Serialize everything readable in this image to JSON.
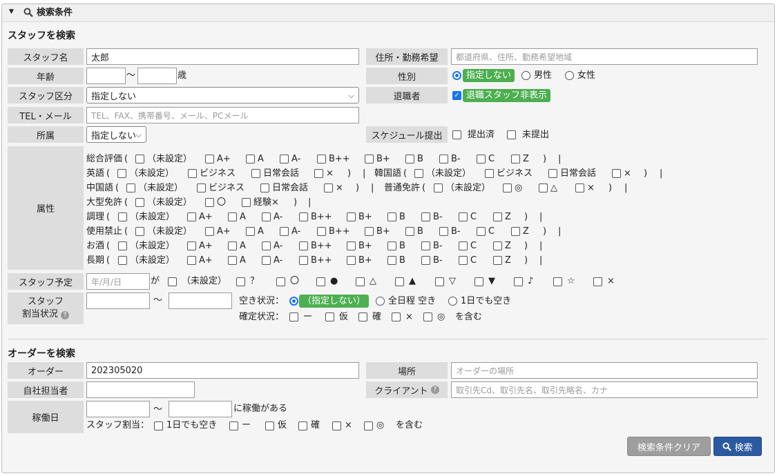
{
  "header": {
    "title": "検索条件"
  },
  "staff": {
    "title": "スタッフを検索",
    "name_label": "スタッフ名",
    "name_value": "太郎",
    "address_label": "住所・勤務希望",
    "address_placeholder": "都道府県、住所、勤務希望地域",
    "age_label": "年齢",
    "age_sep": "〜",
    "age_unit": "歳",
    "gender_label": "性別",
    "gender_options": [
      "指定しない",
      "男性",
      "女性"
    ],
    "category_label": "スタッフ区分",
    "category_value": "指定しない",
    "retired_label": "退職者",
    "retired_option": "退職スタッフ非表示",
    "tel_label": "TEL・メール",
    "tel_placeholder": "TEL、FAX、携帯番号、メール、PCメール",
    "belong_label": "所属",
    "belong_value": "指定しない",
    "schedule_label": "スケジュール提出",
    "schedule_options": [
      "提出済",
      "未提出"
    ],
    "attr_label": "属性",
    "attrs": [
      {
        "name": "総合評価",
        "items": [
          "（未設定）",
          "A+",
          "A",
          "A-",
          "B++",
          "B+",
          "B",
          "B-",
          "C",
          "Z"
        ]
      },
      {
        "name": "英語",
        "items": [
          "（未設定）",
          "ビジネス",
          "日常会話",
          "×"
        ]
      },
      {
        "name": "韓国語",
        "items": [
          "（未設定）",
          "ビジネス",
          "日常会話",
          "×"
        ]
      },
      {
        "name": "中国語",
        "items": [
          "（未設定）",
          "ビジネス",
          "日常会話",
          "×"
        ]
      },
      {
        "name": "普通免許",
        "items": [
          "（未設定）",
          "◎",
          "△",
          "×"
        ]
      },
      {
        "name": "大型免許",
        "items": [
          "（未設定）",
          "〇",
          "経験×"
        ]
      },
      {
        "name": "調理",
        "items": [
          "（未設定）",
          "A+",
          "A",
          "A-",
          "B++",
          "B+",
          "B",
          "B-",
          "C",
          "Z"
        ]
      },
      {
        "name": "使用禁止",
        "items": [
          "（未設定）",
          "A+",
          "A",
          "A-",
          "B++",
          "B+",
          "B",
          "B-",
          "C",
          "Z"
        ]
      },
      {
        "name": "お酒",
        "items": [
          "（未設定）",
          "A+",
          "A",
          "A-",
          "B++",
          "B+",
          "B",
          "B-",
          "C",
          "Z"
        ]
      },
      {
        "name": "長期",
        "items": [
          "（未設定）",
          "A+",
          "A",
          "A-",
          "B++",
          "B+",
          "B",
          "B-",
          "C",
          "Z"
        ]
      }
    ],
    "plan_label": "スタッフ予定",
    "plan_placeholder": "年/月/日",
    "plan_ga": "が",
    "plan_items": [
      "（未設定）",
      "？",
      "〇",
      "●",
      "△",
      "▲",
      "▽",
      "▼",
      "♪",
      "☆",
      "×"
    ],
    "assign_label1": "スタッフ",
    "assign_label2": "割当状況",
    "vacancy_label": "空き状況：",
    "vacancy_options": [
      "（指定しない）",
      "全日程 空き",
      "1日でも空き"
    ],
    "confirm_label": "確定状況：",
    "confirm_items": [
      "ー",
      "仮",
      "確",
      "×",
      "◎"
    ],
    "confirm_suffix": "を含む"
  },
  "order": {
    "title": "オーダーを検索",
    "order_label": "オーダー",
    "order_value": "202305020",
    "place_label": "場所",
    "place_placeholder": "オーダーの場所",
    "owner_label": "自社担当者",
    "client_label": "クライアント",
    "client_placeholder": "取引先Cd、取引先名、取引先略名、カナ",
    "work_label": "稼働日",
    "work_sep": "〜",
    "work_suffix": "に稼働がある",
    "staff_assign_label": "スタッフ割当：",
    "staff_assign_items": [
      "1日でも空き",
      "ー",
      "仮",
      "確",
      "×",
      "◎"
    ],
    "staff_assign_suffix": "を含む",
    "clear_button": "検索条件クリア",
    "search_button": "検索"
  },
  "colors": {
    "accent": "#4caf50",
    "primary": "#2c5aa0",
    "clear": "#9e9e9e"
  }
}
